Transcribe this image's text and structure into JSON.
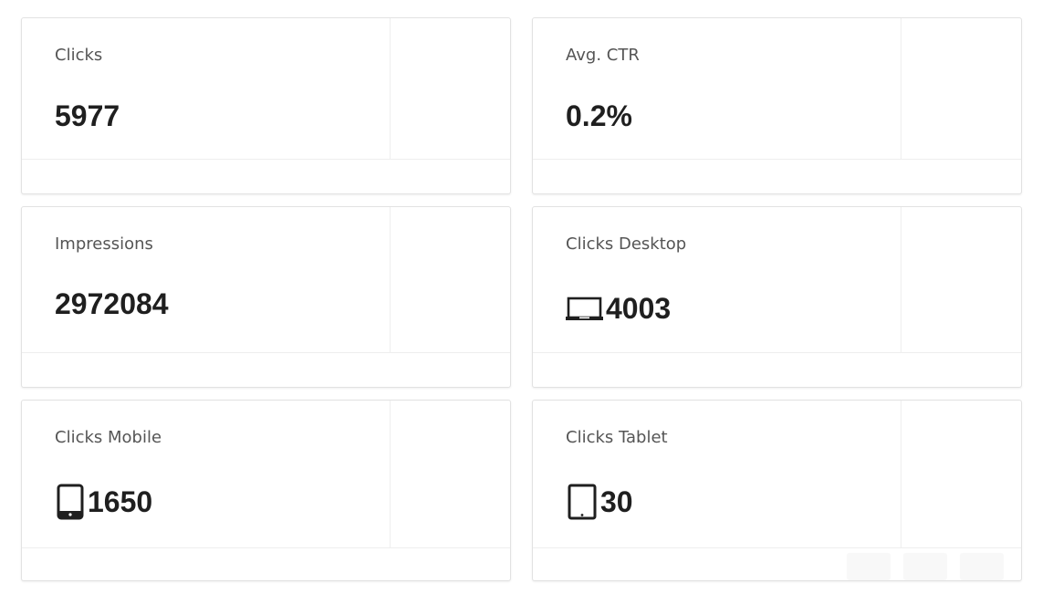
{
  "cards": [
    {
      "label": "Clicks",
      "value": "5977",
      "icon": null
    },
    {
      "label": "Avg. CTR",
      "value": "0.2%",
      "icon": null
    },
    {
      "label": "Impressions",
      "value": "2972084",
      "icon": null
    },
    {
      "label": "Clicks Desktop",
      "value": "4003",
      "icon": "laptop-icon"
    },
    {
      "label": "Clicks Mobile",
      "value": "1650",
      "icon": "mobile-phone-icon"
    },
    {
      "label": "Clicks Tablet",
      "value": "30",
      "icon": "tablet-icon"
    }
  ],
  "colors": {
    "value_text": "#1f1f1f",
    "label_text": "#555555",
    "card_border": "#e2e2e2"
  }
}
